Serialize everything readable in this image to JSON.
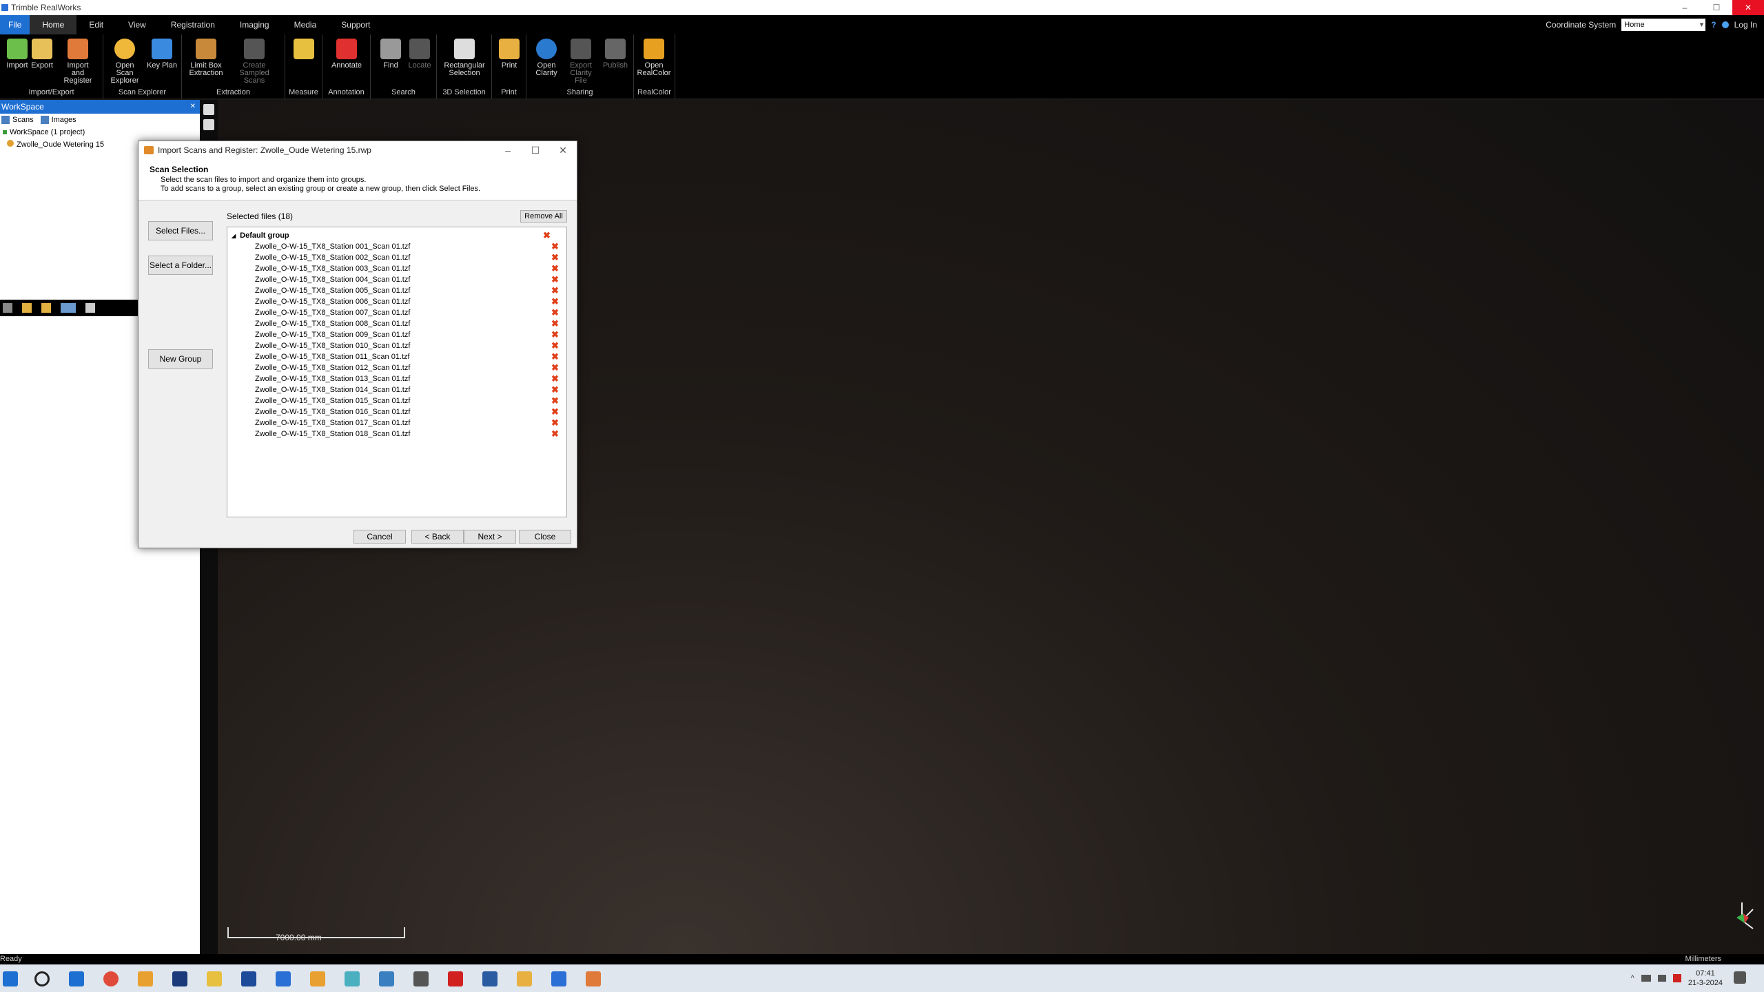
{
  "window": {
    "title": "Trimble RealWorks",
    "minimize_glyph": "–",
    "maximize_glyph": "☐",
    "close_glyph": "✕"
  },
  "menu": {
    "items": [
      "File",
      "Home",
      "Edit",
      "View",
      "Registration",
      "Imaging",
      "Media",
      "Support"
    ],
    "coordinate_system_label": "Coordinate System",
    "coordinate_system_value": "Home",
    "help_glyph": "?",
    "login_label": "Log In"
  },
  "ribbon": {
    "groups": [
      {
        "label": "Import/Export",
        "buttons": [
          "Import",
          "Export",
          "Import and Register"
        ]
      },
      {
        "label": "Scan Explorer",
        "buttons": [
          "Open Scan Explorer",
          "Key Plan"
        ]
      },
      {
        "label": "Extraction",
        "buttons": [
          "Limit Box Extraction",
          "Create Sampled Scans"
        ]
      },
      {
        "label": "Measure",
        "buttons": [
          ""
        ]
      },
      {
        "label": "Annotation",
        "buttons": [
          "Annotate"
        ]
      },
      {
        "label": "Search",
        "buttons": [
          "Find",
          "Locate"
        ]
      },
      {
        "label": "3D Selection",
        "buttons": [
          "Rectangular Selection"
        ]
      },
      {
        "label": "Print",
        "buttons": [
          "Print"
        ]
      },
      {
        "label": "Sharing",
        "buttons": [
          "Open Clarity",
          "Export Clarity File",
          "Publish"
        ]
      },
      {
        "label": "RealColor",
        "buttons": [
          "Open RealColor"
        ]
      }
    ]
  },
  "workspace": {
    "header": "WorkSpace",
    "pin_glyph": "✕",
    "tabs": [
      "Scans",
      "Images"
    ],
    "tree": [
      "WorkSpace (1 project)",
      "Zwolle_Oude Wetering 15"
    ]
  },
  "dialog": {
    "title": "Import Scans and Register: Zwolle_Oude Wetering 15.rwp",
    "header_title": "Scan Selection",
    "header_line1": "Select the scan files to import and organize them into groups.",
    "header_line2": "To add scans to a group, select an existing group or create a new group, then click Select Files.",
    "select_files": "Select Files...",
    "select_folder": "Select a Folder...",
    "new_group": "New Group",
    "selected_label": "Selected files (18)",
    "remove_all": "Remove All",
    "group_name": "Default group",
    "remove_glyph": "✖",
    "expand_glyph": "◢",
    "files": [
      "Zwolle_O-W-15_TX8_Station 001_Scan 01.tzf",
      "Zwolle_O-W-15_TX8_Station 002_Scan 01.tzf",
      "Zwolle_O-W-15_TX8_Station 003_Scan 01.tzf",
      "Zwolle_O-W-15_TX8_Station 004_Scan 01.tzf",
      "Zwolle_O-W-15_TX8_Station 005_Scan 01.tzf",
      "Zwolle_O-W-15_TX8_Station 006_Scan 01.tzf",
      "Zwolle_O-W-15_TX8_Station 007_Scan 01.tzf",
      "Zwolle_O-W-15_TX8_Station 008_Scan 01.tzf",
      "Zwolle_O-W-15_TX8_Station 009_Scan 01.tzf",
      "Zwolle_O-W-15_TX8_Station 010_Scan 01.tzf",
      "Zwolle_O-W-15_TX8_Station 011_Scan 01.tzf",
      "Zwolle_O-W-15_TX8_Station 012_Scan 01.tzf",
      "Zwolle_O-W-15_TX8_Station 013_Scan 01.tzf",
      "Zwolle_O-W-15_TX8_Station 014_Scan 01.tzf",
      "Zwolle_O-W-15_TX8_Station 015_Scan 01.tzf",
      "Zwolle_O-W-15_TX8_Station 016_Scan 01.tzf",
      "Zwolle_O-W-15_TX8_Station 017_Scan 01.tzf",
      "Zwolle_O-W-15_TX8_Station 018_Scan 01.tzf"
    ],
    "cancel": "Cancel",
    "back": "< Back",
    "next": "Next >",
    "close": "Close"
  },
  "viewport": {
    "scale_label": "7000.00 mm"
  },
  "status": {
    "text": "Ready",
    "units": "Millimeters"
  },
  "taskbar": {
    "time": "07:41",
    "date": "21-3-2024"
  },
  "colors": {
    "accent": "#1e6fd2",
    "remove_red": "#e0401a",
    "viewport_bg": "#1f1a17"
  }
}
